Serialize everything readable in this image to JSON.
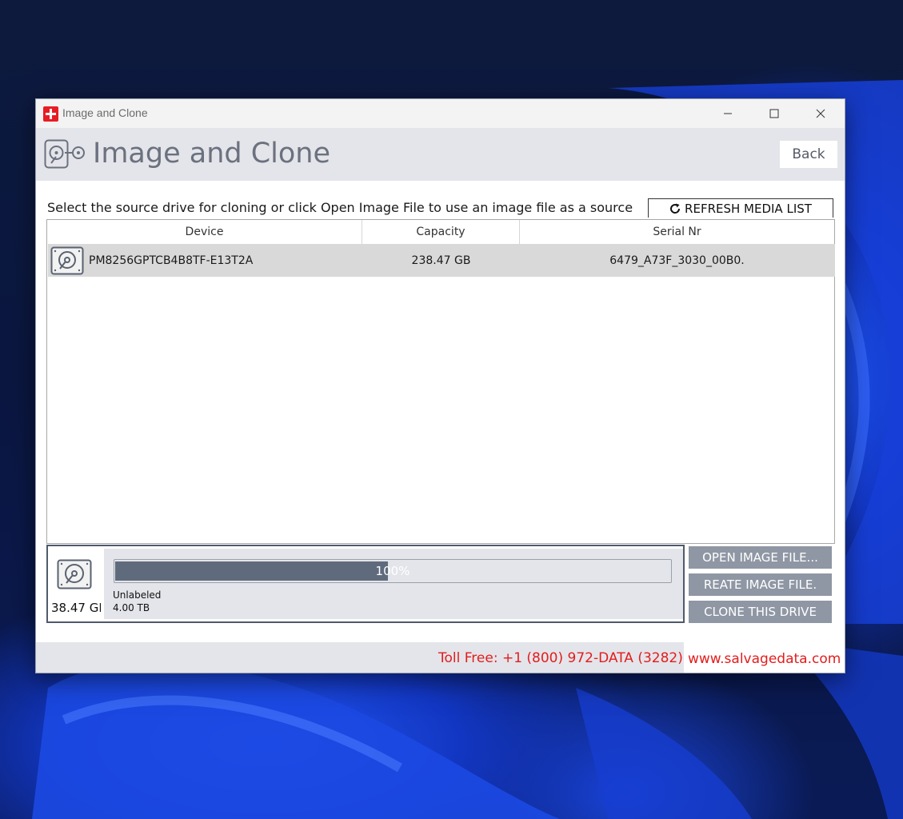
{
  "window": {
    "title": "Image and Clone"
  },
  "header": {
    "title": "Image and Clone",
    "back_label": "Back"
  },
  "instruction": "Select the source drive for cloning or click Open Image File to use an image file as a source",
  "refresh_label": "REFRESH MEDIA LIST",
  "table": {
    "columns": [
      "Device",
      "Capacity",
      "Serial Nr"
    ],
    "rows": [
      {
        "device": "PM8256GPTCB4B8TF-E13T2A",
        "capacity": "238.47 GB",
        "serial": "6479_A73F_3030_00B0."
      }
    ]
  },
  "selected_drive": {
    "size": "38.47 GI",
    "progress_percent": 49,
    "progress_text": "100%",
    "volume_label": "Unlabeled",
    "volume_size": "4.00 TB"
  },
  "actions": {
    "open_image": "OPEN IMAGE FILE...",
    "create_image": "REATE IMAGE FILE.",
    "clone": "CLONE THIS DRIVE"
  },
  "footer": {
    "toll_free": "Toll Free: +1 (800) 972-DATA (3282)",
    "website": "www.salvagedata.com"
  },
  "colors": {
    "accent_gray": "#8f97a4",
    "progress_fill": "#5f6b7d",
    "footer_text": "#e21d1d",
    "app_icon_red": "#e81c24"
  },
  "icons": [
    "app-logo-icon",
    "minimize-icon",
    "maximize-icon",
    "close-icon",
    "drive-clone-icon",
    "refresh-icon",
    "hard-drive-icon"
  ]
}
